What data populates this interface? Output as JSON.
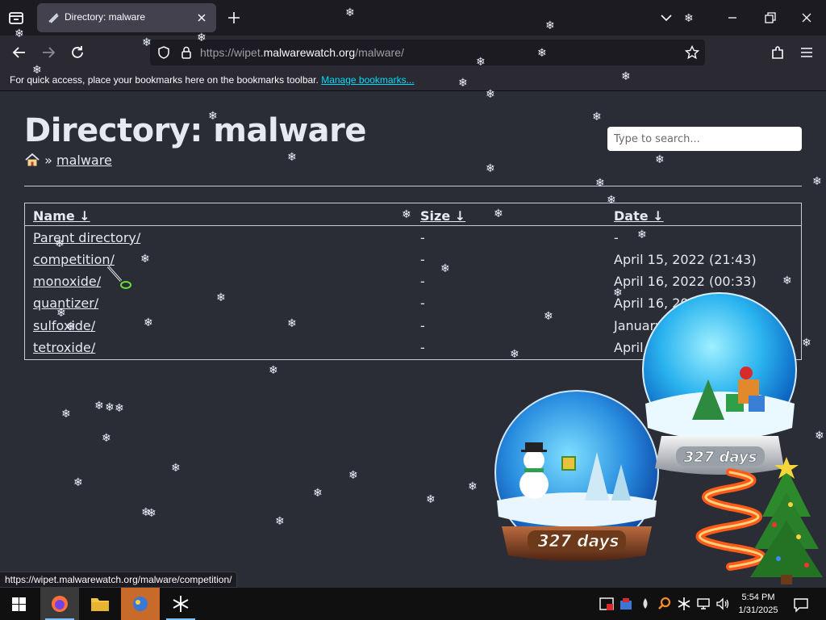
{
  "browser": {
    "tab": {
      "title": "Directory: malware"
    },
    "url": {
      "prefix": "https://wipet.",
      "host": "malwarewatch.org",
      "path": "/malware/"
    },
    "bookmarks_bar": {
      "message": "For quick access, place your bookmarks here on the bookmarks toolbar.",
      "link": "Manage bookmarks..."
    },
    "status_url": "https://wipet.malwarewatch.org/malware/competition/"
  },
  "page": {
    "title": "Directory: malware",
    "breadcrumb": {
      "separator": "»",
      "current": "malware"
    },
    "search": {
      "placeholder": "Type to search..."
    },
    "columns": {
      "name": "Name ↓",
      "size": "Size ↓",
      "date": "Date ↓"
    },
    "rows": [
      {
        "name": "Parent directory/",
        "size": "-",
        "date": "-"
      },
      {
        "name": "competition/",
        "size": "-",
        "date": "April 15, 2022 (21:43)"
      },
      {
        "name": "monoxide/",
        "size": "-",
        "date": "April 16, 2022 (00:33)"
      },
      {
        "name": "quantizer/",
        "size": "-",
        "date": "April 16, 2022"
      },
      {
        "name": "sulfoxide/",
        "size": "-",
        "date": "January"
      },
      {
        "name": "tetroxide/",
        "size": "-",
        "date": "April 1"
      }
    ]
  },
  "desktop_widgets": {
    "globe_left_label": "327 days",
    "globe_right_label": "327 days"
  },
  "taskbar": {
    "clock": {
      "time": "5:54 PM",
      "date": "1/31/2025"
    }
  },
  "colors": {
    "page_bg": "#2a2d36",
    "chrome_bg": "#2b2a33",
    "tab_active": "#42414d",
    "link_blue": "#00ddff"
  }
}
